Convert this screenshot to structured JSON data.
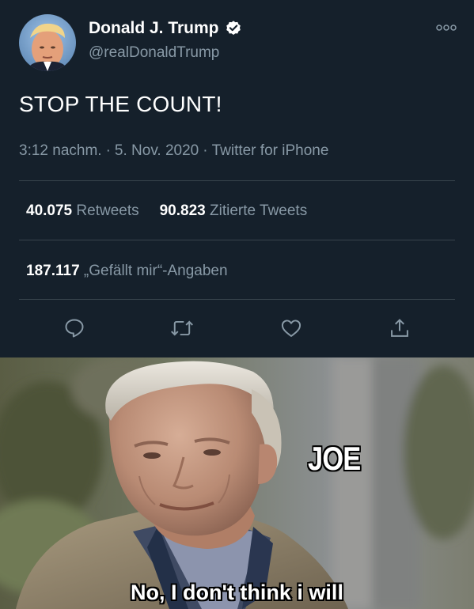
{
  "tweet": {
    "author_name": "Donald J. Trump",
    "author_handle": "@realDonaldTrump",
    "text": "STOP THE COUNT!",
    "time": "3:12 nachm.",
    "date": "5. Nov. 2020",
    "source": "Twitter for iPhone",
    "meta_separator": "·",
    "retweets_count": "40.075",
    "retweets_label": "Retweets",
    "quotes_count": "90.823",
    "quotes_label": "Zitierte Tweets",
    "likes_count": "187.117",
    "likes_label": "„Gefällt mir“-Angaben",
    "icons": [
      "verified-badge-icon",
      "more-options-icon",
      "reply-icon",
      "retweet-icon",
      "like-icon",
      "share-icon"
    ]
  },
  "meme": {
    "label": "JOE",
    "caption": "No, I don't think i will"
  },
  "colors": {
    "background": "#15202b",
    "secondary_text": "#8899a6",
    "divider": "#38444d",
    "verified": "#ffffff",
    "text": "#ffffff"
  }
}
